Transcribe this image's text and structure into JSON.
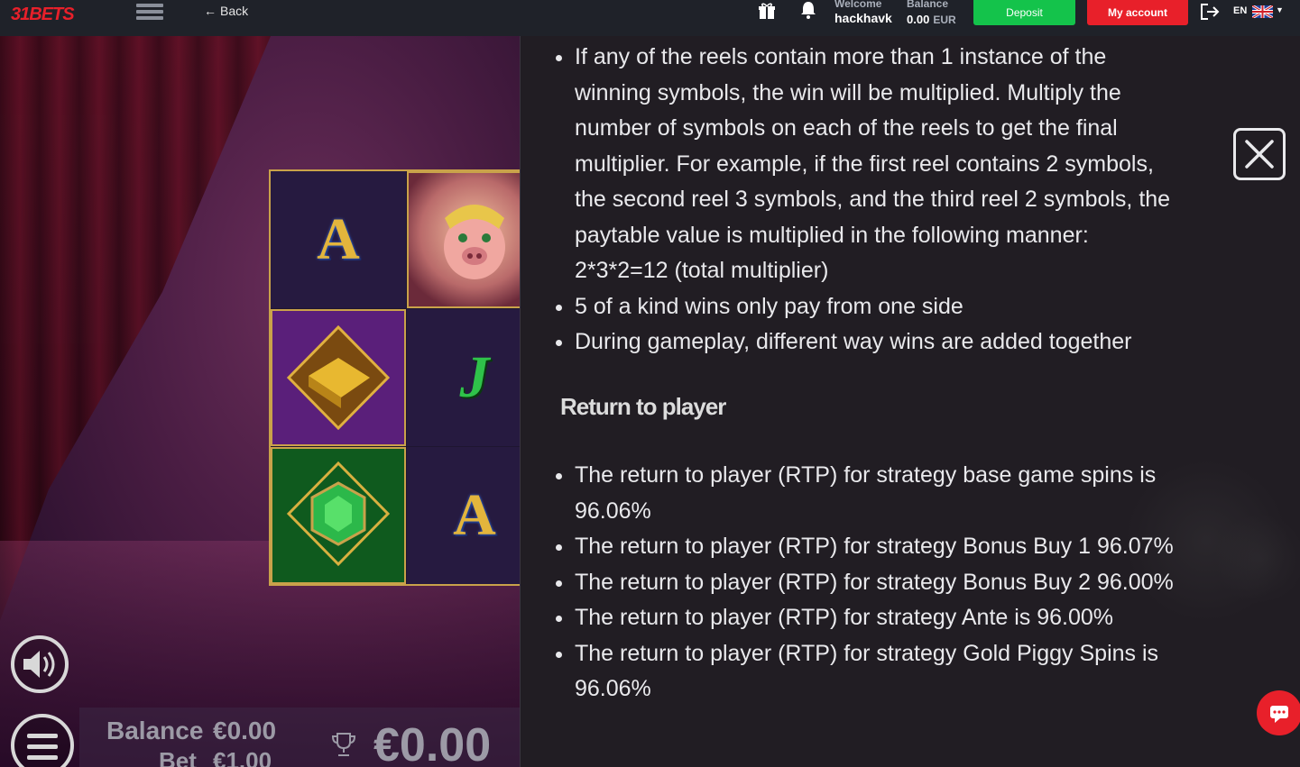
{
  "header": {
    "logo_prefix": "31",
    "logo_suffix": "BETS",
    "back_label": "Back",
    "welcome_label": "Welcome",
    "username": "hackhavk",
    "balance_label": "Balance",
    "balance_value": "0.00",
    "balance_currency": "EUR",
    "deposit_label": "Deposit",
    "account_label": "My account",
    "language": "EN",
    "icons": [
      "menu-icon",
      "arrow-left-icon",
      "gift-icon",
      "bell-icon",
      "logout-icon",
      "uk-flag-icon",
      "chevron-down-icon"
    ]
  },
  "game": {
    "reel_symbols": [
      [
        "A",
        "pig"
      ],
      [
        "gold-gem",
        "J"
      ],
      [
        "emerald-gem",
        "A"
      ]
    ],
    "bar": {
      "balance_label": "Balance",
      "balance_value": "€0.00",
      "bet_label": "Bet",
      "bet_value": "€1.00",
      "win_value": "€0.00"
    },
    "icons": [
      "sound-icon",
      "menu-icon",
      "trophy-icon"
    ]
  },
  "info": {
    "rules": [
      "If any of the reels contain more than 1 instance of the winning symbols, the win will be multiplied. Multiply the number of symbols on each of the reels to get the final multiplier. For example, if the first reel contains 2 symbols, the second reel 3 symbols, and the third reel 2 symbols, the paytable value is multiplied in the following manner: 2*3*2=12 (total multiplier)",
      "5 of a kind wins only pay from one side",
      "During gameplay, different way wins are added together"
    ],
    "rtp_heading": "Return to player",
    "rtp_items": [
      "The return to player (RTP) for strategy base game spins is 96.06%",
      "The return to player (RTP) for strategy Bonus Buy 1 96.07%",
      "The return to player (RTP) for strategy Bonus Buy 2 96.00%",
      "The return to player (RTP) for strategy Ante is 96.00%",
      "The return to player (RTP) for strategy Gold Piggy Spins is 96.06%"
    ],
    "icons": [
      "close-icon",
      "chat-icon"
    ]
  },
  "colors": {
    "brand_red": "#e8202a",
    "deposit_green": "#14c34b",
    "topbar_bg": "#1f2229",
    "panel_bg": "#221e24"
  }
}
